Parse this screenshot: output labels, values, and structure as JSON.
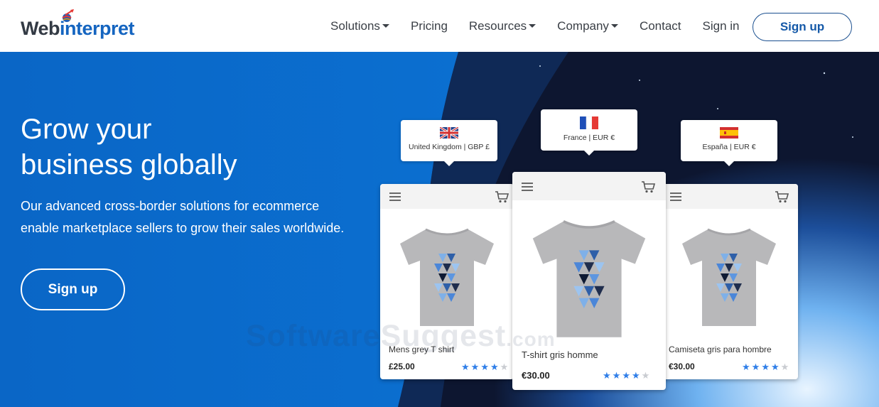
{
  "brand": {
    "logo_web": "Web",
    "logo_interpret": "interpret"
  },
  "nav": {
    "items": [
      {
        "label": "Solutions",
        "dropdown": true
      },
      {
        "label": "Pricing",
        "dropdown": false
      },
      {
        "label": "Resources",
        "dropdown": true
      },
      {
        "label": "Company",
        "dropdown": true
      },
      {
        "label": "Contact",
        "dropdown": false
      },
      {
        "label": "Sign in",
        "dropdown": false
      }
    ],
    "signup_label": "Sign up"
  },
  "hero": {
    "title_line1": "Grow your",
    "title_line2": "business globally",
    "desc_line1": "Our advanced cross-border solutions for ecommerce",
    "desc_line2": "enable marketplace sellers to grow their sales worldwide.",
    "signup_label": "Sign up"
  },
  "markets": [
    {
      "label": "United Kingdom | GBP £",
      "flag": "uk-flag-icon"
    },
    {
      "label": "France | EUR €",
      "flag": "france-flag-icon"
    },
    {
      "label": "España | EUR €",
      "flag": "spain-flag-icon"
    }
  ],
  "products": [
    {
      "name": "Mens grey T shirt",
      "price": "£25.00",
      "rating": 4,
      "max_rating": 5
    },
    {
      "name": "T-shirt gris homme",
      "price": "€30.00",
      "rating": 4,
      "max_rating": 5
    },
    {
      "name": "Camiseta gris para hombre",
      "price": "€30.00",
      "rating": 4,
      "max_rating": 5
    }
  ],
  "watermark": {
    "text": "SoftwareSuggest",
    "suffix": ".com"
  },
  "colors": {
    "hero_blue": "#0b6bc9",
    "brand_blue": "#1565c0",
    "star_blue": "#2f7ee8",
    "space_dark": "#0d1630"
  }
}
